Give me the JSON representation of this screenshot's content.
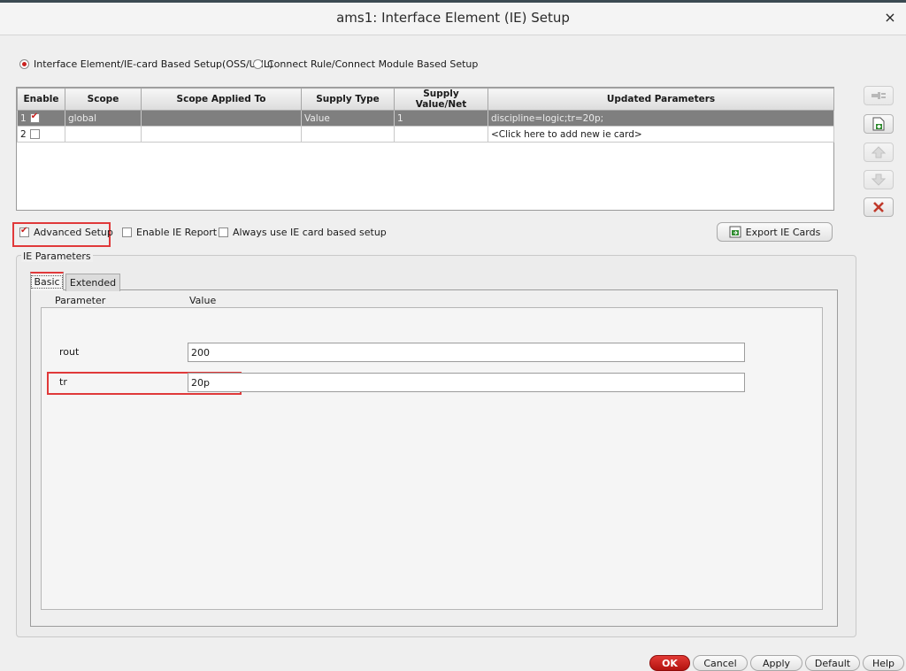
{
  "window": {
    "title": "ams1: Interface Element (IE) Setup",
    "close_glyph": "×"
  },
  "mode": {
    "option1": "Interface Element/IE-card Based Setup(OSS/UNL)",
    "option2": "Connect Rule/Connect Module Based Setup",
    "selected": "option1"
  },
  "table": {
    "headers": [
      "Enable",
      "Scope",
      "Scope Applied To",
      "Supply Type",
      "Supply Value/Net",
      "Updated Parameters"
    ],
    "rows": [
      {
        "num": "1",
        "enabled": true,
        "scope": "global",
        "scope_applied_to": "",
        "supply_type": "Value",
        "supply_value": "1",
        "updated_parameters": "discipline=logic;tr=20p;"
      },
      {
        "num": "2",
        "enabled": false,
        "scope": "",
        "scope_applied_to": "",
        "supply_type": "",
        "supply_value": "",
        "updated_parameters": "<Click here to add new ie card>"
      }
    ]
  },
  "side_buttons": [
    {
      "icon": "connector-icon",
      "enabled": false
    },
    {
      "icon": "add-card-icon",
      "enabled": true
    },
    {
      "icon": "arrow-up-icon",
      "enabled": false
    },
    {
      "icon": "arrow-down-icon",
      "enabled": false
    },
    {
      "icon": "delete-icon",
      "enabled": true
    }
  ],
  "options": {
    "advanced_setup": "Advanced Setup",
    "enable_ie_report": "Enable IE Report",
    "always_use": "Always use IE card based setup"
  },
  "export_button": "Export IE Cards",
  "ie_params": {
    "legend": "IE Parameters",
    "tabs": [
      "Basic",
      "Extended"
    ],
    "col_parameter": "Parameter",
    "col_value": "Value",
    "rows": [
      {
        "name": "rout",
        "value": "200"
      },
      {
        "name": "tr",
        "value": "20p"
      }
    ]
  },
  "footer": {
    "ok": "OK",
    "cancel": "Cancel",
    "apply": "Apply",
    "default": "Default",
    "help": "Help"
  },
  "colors": {
    "accent_red": "#e0393a",
    "selected_row": "#7f7f7f"
  }
}
